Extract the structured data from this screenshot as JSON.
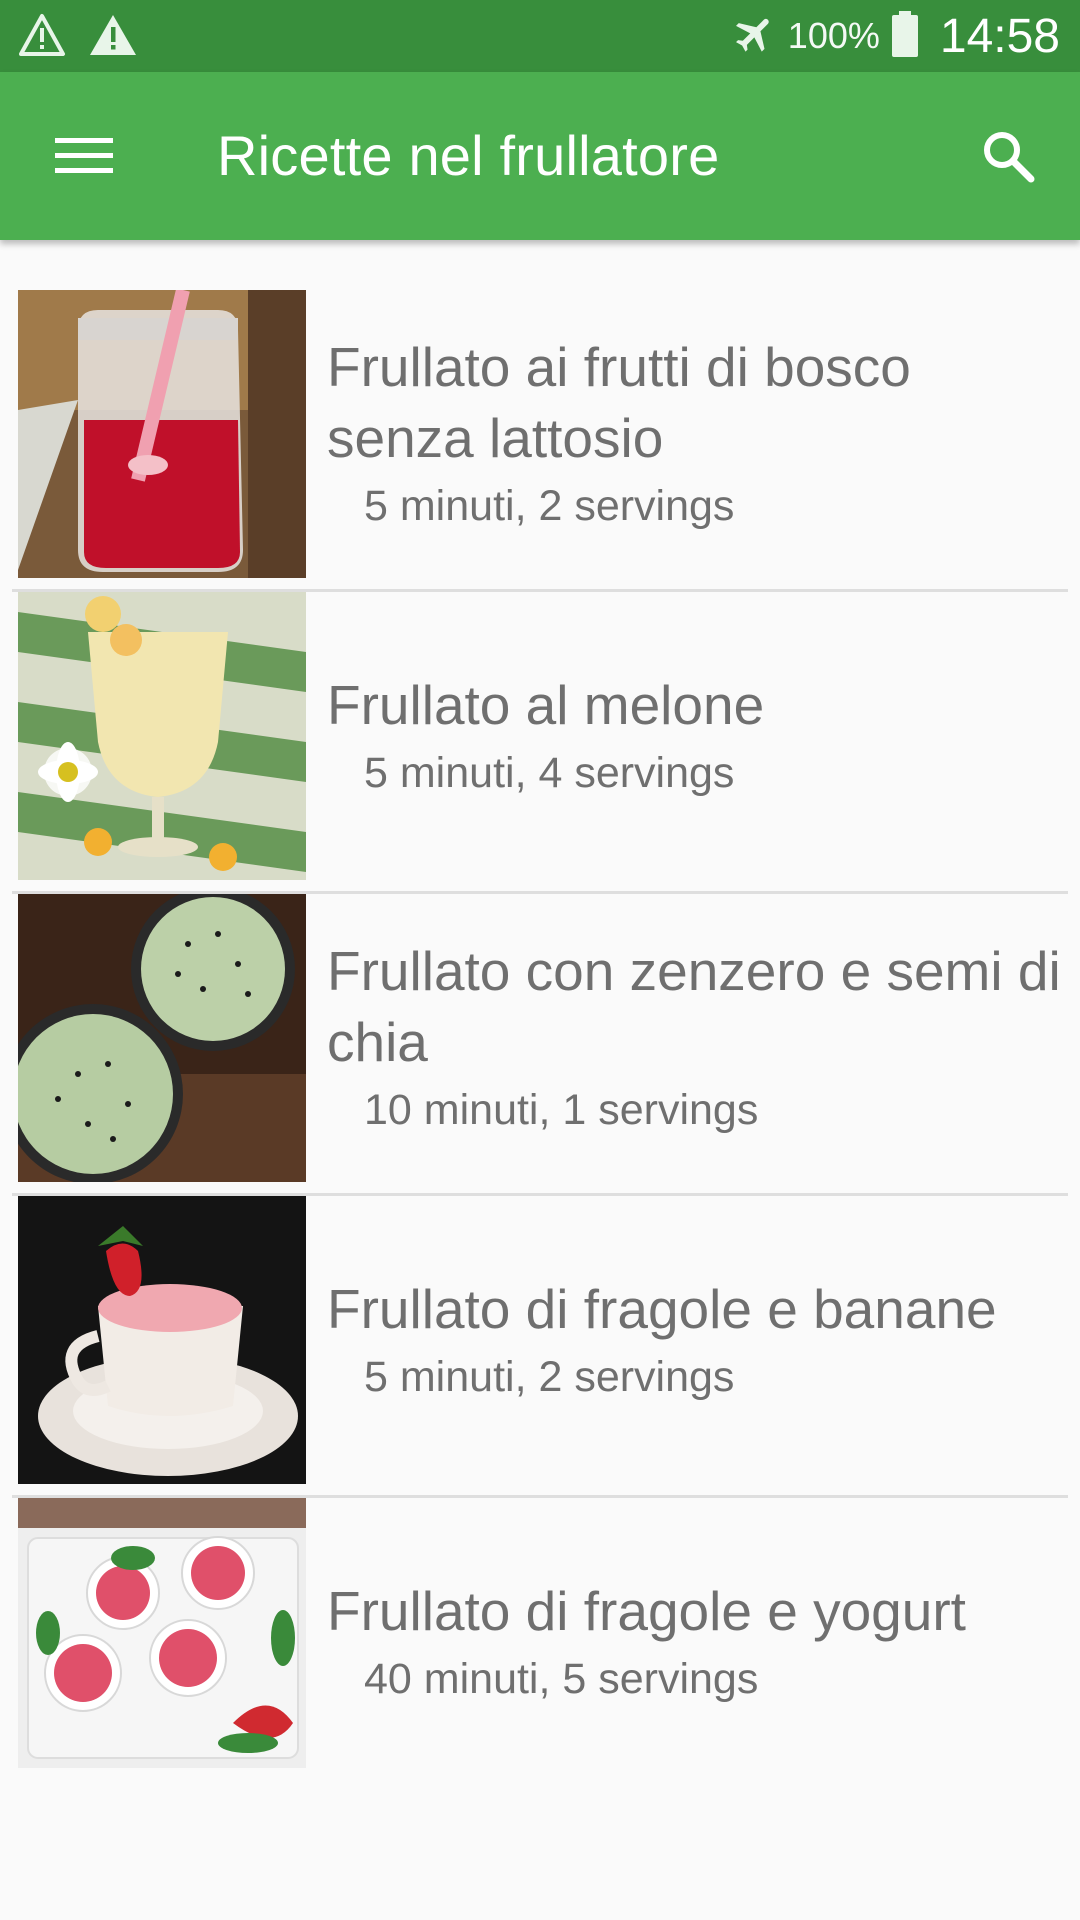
{
  "status_bar": {
    "battery": "100%",
    "time": "14:58"
  },
  "app_bar": {
    "title": "Ricette nel frullatore"
  },
  "recipes": [
    {
      "title": "Frullato ai frutti di bosco senza lattosio",
      "meta": "5 minuti, 2 servings"
    },
    {
      "title": "Frullato al melone",
      "meta": "5 minuti, 4 servings"
    },
    {
      "title": "Frullato con zenzero e semi di chia",
      "meta": "10 minuti, 1 servings"
    },
    {
      "title": "Frullato di fragole e banane",
      "meta": "5 minuti, 2 servings"
    },
    {
      "title": "Frullato di fragole e yogurt",
      "meta": "40 minuti, 5 servings"
    }
  ],
  "colors": {
    "app_bar": "#4caf50",
    "status_bar": "#388e3c",
    "text": "#6f6f6f"
  },
  "icons": [
    "warning-icon",
    "airplane-mode-icon",
    "battery-icon",
    "menu-icon",
    "search-icon"
  ]
}
